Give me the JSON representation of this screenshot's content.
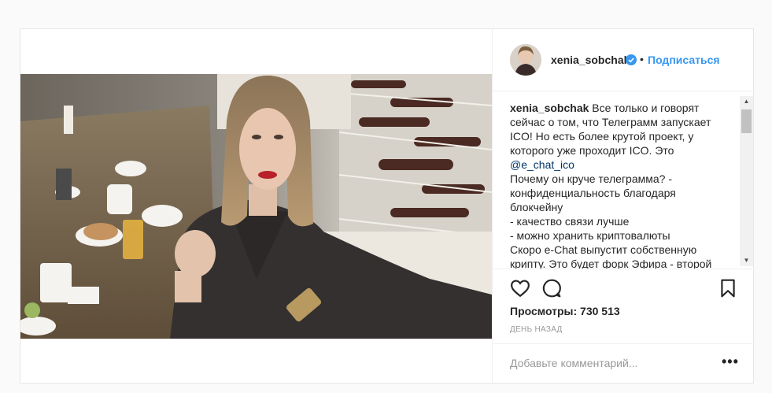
{
  "post": {
    "username": "xenia_sobchak",
    "separator": "•",
    "follow_label": "Подписаться",
    "caption": {
      "username": "xenia_sobchak",
      "line1": "Все только и говорят",
      "line2": "сейчас о том, что Телеграмм запускает",
      "line3": "ICO! Но есть более крутой проект, у",
      "line4": "которого уже проходит ICO. Это",
      "mention": "@e_chat_ico",
      "line6": "Почему он круче телеграмма? -",
      "line7": "конфиденциальность благодаря",
      "line8": "блокчейну",
      "line9": "- качество связи лучше",
      "line10": "- можно хранить криптовалюты",
      "line11": "Скоро e-Chat выпустит собственную",
      "line12": "крипту. Это будет форк Эфира - второй"
    },
    "views_label": "Просмотры: 730 513",
    "time_label": "ДЕНЬ НАЗАД",
    "comment_placeholder": "Добавьте комментарий...",
    "more_label": "•••"
  },
  "icons": {
    "verified": "verified-badge-icon",
    "like": "heart-icon",
    "comment": "comment-bubble-icon",
    "save": "bookmark-icon",
    "more": "more-options-icon"
  },
  "colors": {
    "accent": "#3897f0",
    "text": "#262626",
    "muted": "#999999",
    "border": "#efefef"
  }
}
